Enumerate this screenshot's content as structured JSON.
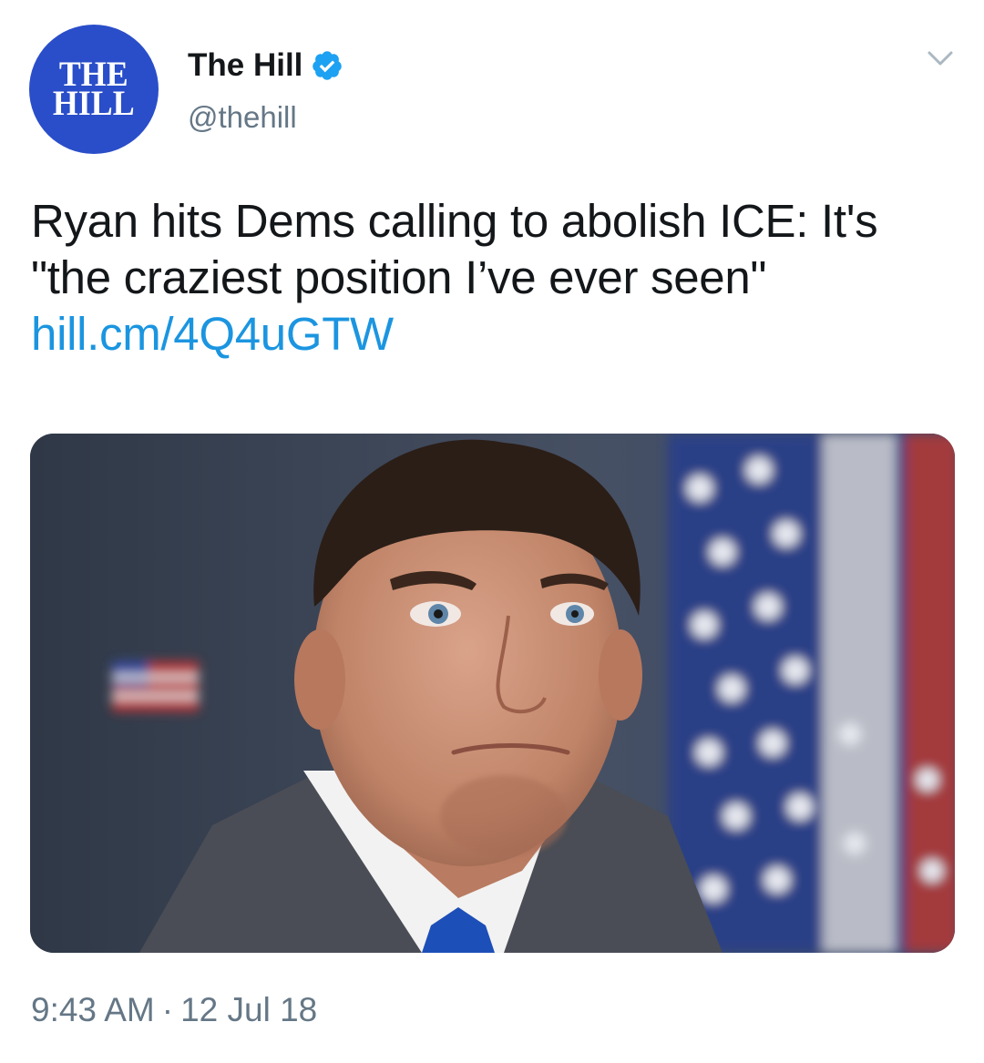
{
  "author": {
    "avatar_logo_line1": "THE",
    "avatar_logo_line2": "HILL",
    "display_name": "The Hill",
    "handle": "@thehill",
    "verified": true
  },
  "tweet": {
    "text": "Ryan hits Dems calling to abolish ICE: It's \"the craziest position I’ve ever seen\" ",
    "link": "hill.cm/4Q4uGTW"
  },
  "meta": {
    "time": "9:43 AM",
    "separator": "·",
    "date": "12 Jul 18"
  },
  "colors": {
    "avatar_bg": "#2a4ec9",
    "link": "#1b95e0",
    "verified": "#1da1f2",
    "secondary_text": "#657786"
  },
  "icons": {
    "verified": "verified-badge-icon",
    "menu": "chevron-down-icon"
  }
}
